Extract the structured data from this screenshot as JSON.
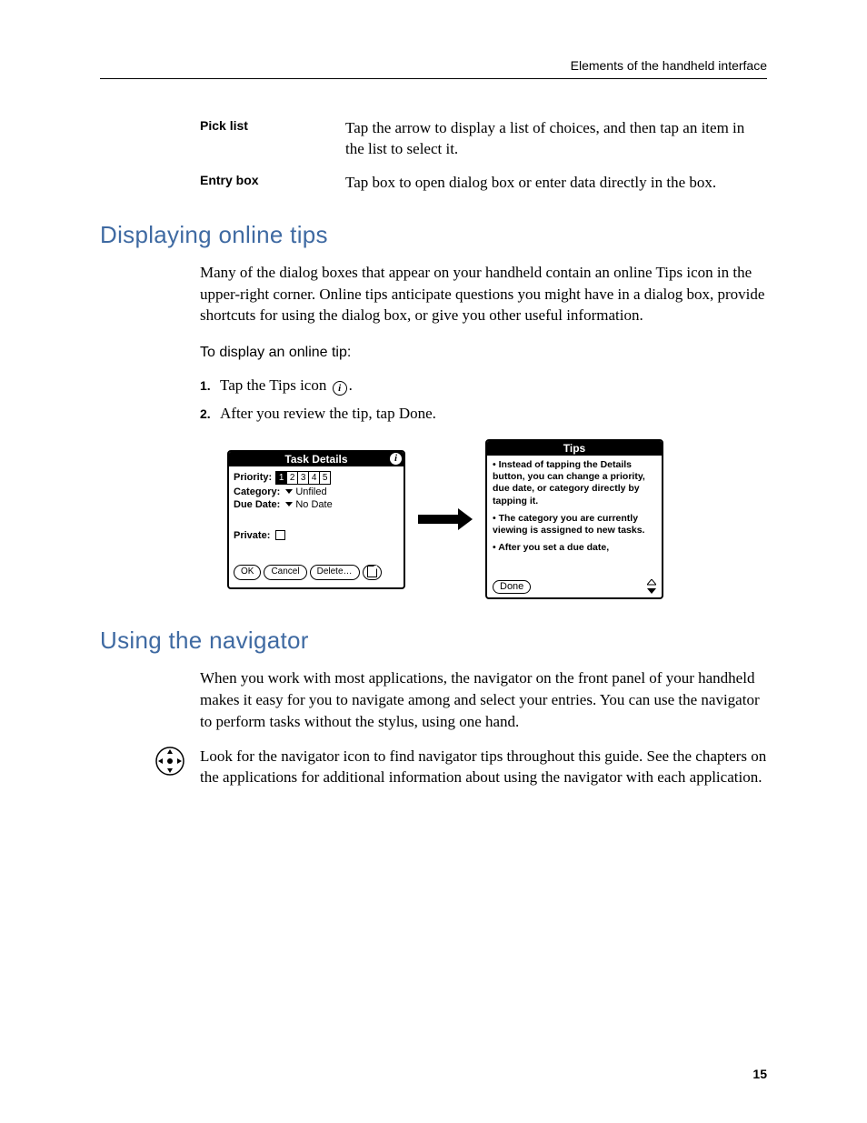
{
  "runningHead": "Elements of the handheld interface",
  "pageNumber": "15",
  "definitions": [
    {
      "term": "Pick list",
      "desc": "Tap the arrow to display a list of choices, and then tap an item in the list to select it."
    },
    {
      "term": "Entry box",
      "desc": "Tap box to open dialog box or enter data directly in the box."
    }
  ],
  "sectionA": {
    "heading": "Displaying online tips",
    "intro": "Many of the dialog boxes that appear on your handheld contain an online Tips icon in the upper-right corner. Online tips anticipate questions you might have in a dialog box, provide shortcuts for using the dialog box, or give you other useful information.",
    "taskHead": "To display an online tip:",
    "steps": [
      {
        "num": "1.",
        "textA": "Tap the Tips icon ",
        "textB": "."
      },
      {
        "num": "2.",
        "textA": "After you review the tip, tap Done.",
        "textB": ""
      }
    ],
    "taskDetails": {
      "title": "Task Details",
      "priorityLabel": "Priority:",
      "priority": [
        "1",
        "2",
        "3",
        "4",
        "5"
      ],
      "prioritySelected": 0,
      "categoryLabel": "Category:",
      "categoryValue": "Unfiled",
      "dueLabel": "Due Date:",
      "dueValue": "No Date",
      "privateLabel": "Private:",
      "buttons": {
        "ok": "OK",
        "cancel": "Cancel",
        "delete": "Delete…"
      }
    },
    "tipsBox": {
      "title": "Tips",
      "lines": [
        "• Instead of tapping the Details button, you can change a priority, due date, or category directly by tapping it.",
        "• The category you are currently viewing is assigned to new tasks.",
        "• After you set a due date,"
      ],
      "done": "Done"
    }
  },
  "sectionB": {
    "heading": "Using the navigator",
    "p1": "When you work with most applications, the navigator on the front panel of your handheld makes it easy for you to navigate among and select your entries. You can use the navigator to perform tasks without the stylus, using one hand.",
    "p2": "Look for the navigator icon to find navigator tips throughout this guide. See the chapters on the applications for additional information about using the navigator with each application."
  }
}
